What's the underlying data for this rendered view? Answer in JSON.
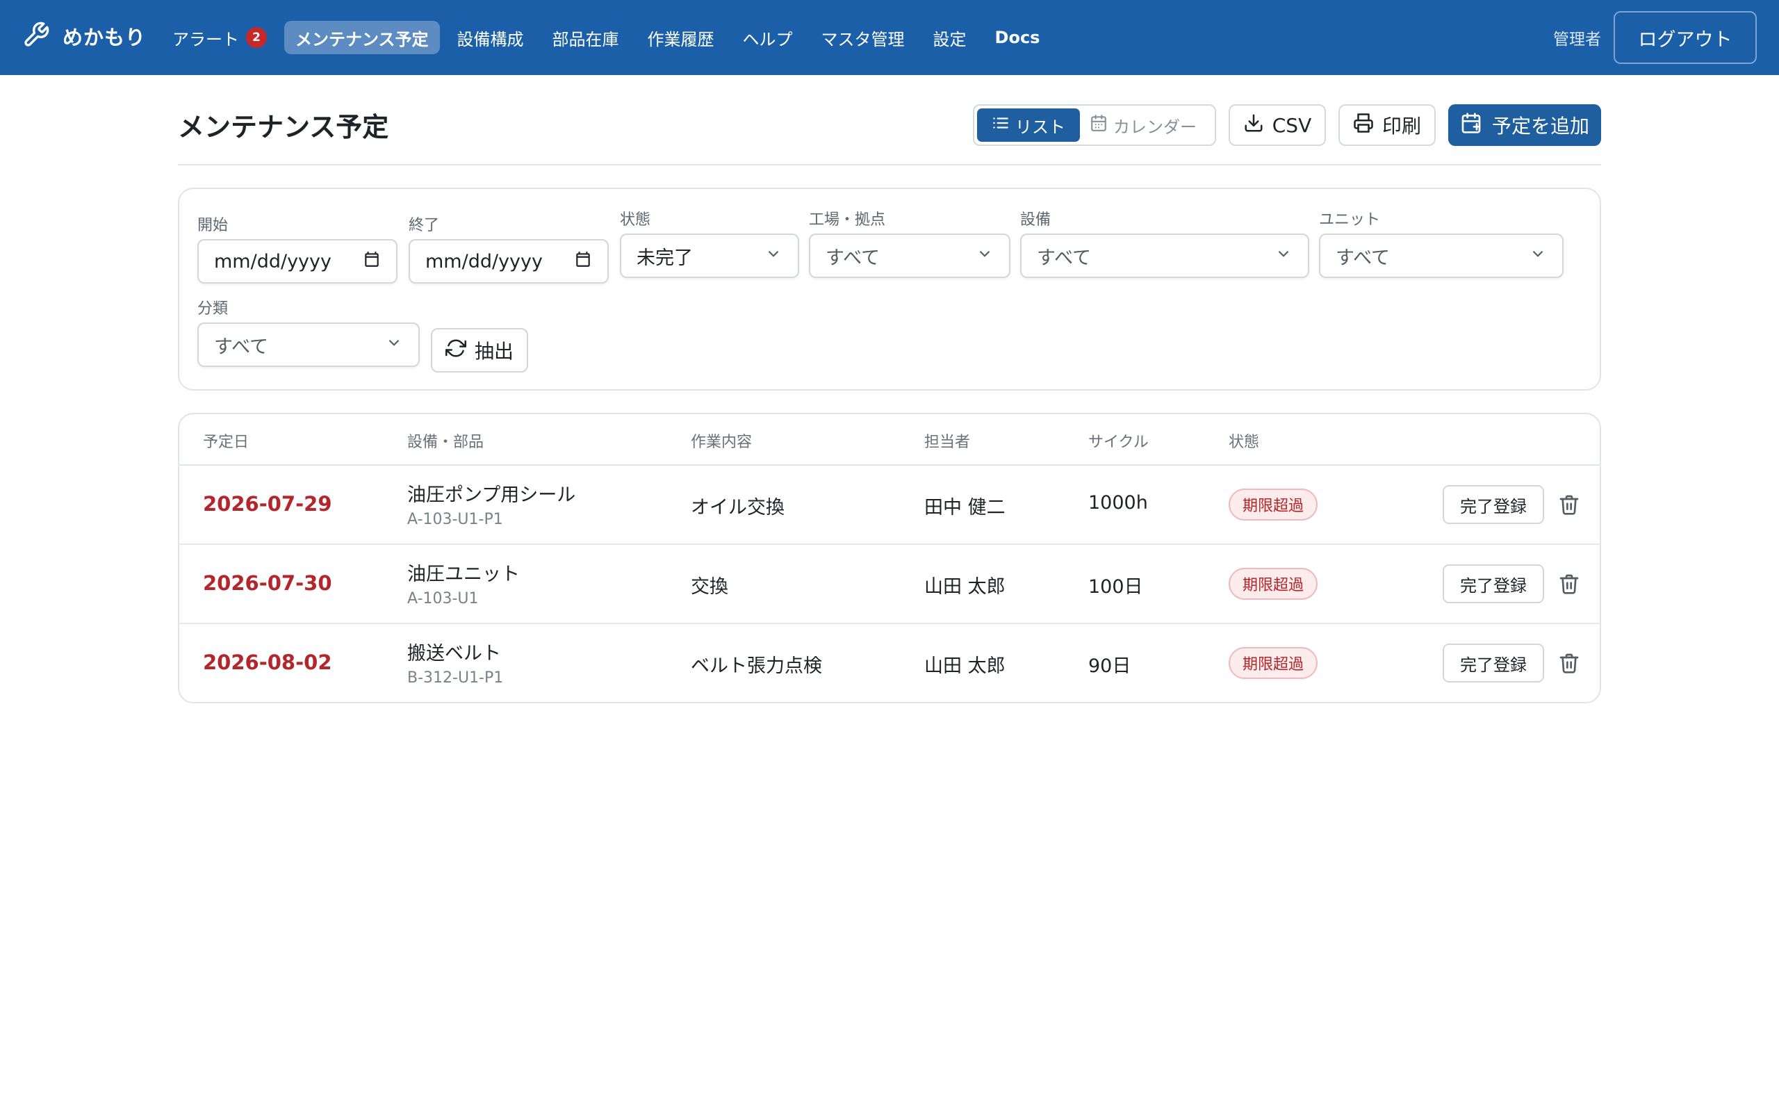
{
  "nav": {
    "brand": "めかもり",
    "items": [
      {
        "label": "アラート",
        "badge": "2"
      },
      {
        "label": "メンテナンス予定"
      },
      {
        "label": "設備構成"
      },
      {
        "label": "部品在庫"
      },
      {
        "label": "作業履歴"
      },
      {
        "label": "ヘルプ"
      },
      {
        "label": "マスタ管理"
      },
      {
        "label": "設定"
      },
      {
        "label": "Docs"
      }
    ],
    "user": "管理者",
    "logout": "ログアウト"
  },
  "header": {
    "title": "メンテナンス予定",
    "view_list": "リスト",
    "view_calendar": "カレンダー",
    "csv": "CSV",
    "print": "印刷",
    "add": "予定を追加"
  },
  "filters": {
    "start_label": "開始",
    "start_value": "mm/dd/yyyy",
    "end_label": "終了",
    "end_value": "mm/dd/yyyy",
    "status_label": "状態",
    "status_value": "未完了",
    "site_label": "工場・拠点",
    "site_value": "すべて",
    "equipment_label": "設備",
    "equipment_value": "すべて",
    "unit_label": "ユニット",
    "unit_value": "すべて",
    "category_label": "分類",
    "category_value": "すべて",
    "extract": "抽出"
  },
  "table": {
    "headers": [
      "予定日",
      "設備・部品",
      "作業内容",
      "担当者",
      "サイクル",
      "状態"
    ],
    "rows": [
      {
        "date": "2026-07-29",
        "part": "油圧ポンプ用シール",
        "code": "A-103-U1-P1",
        "task": "オイル交換",
        "person": "田中 健二",
        "cycle": "1000h",
        "status": "期限超過",
        "action": "完了登録"
      },
      {
        "date": "2026-07-30",
        "part": "油圧ユニット",
        "code": "A-103-U1",
        "task": "交換",
        "person": "山田 太郎",
        "cycle": "100日",
        "status": "期限超過",
        "action": "完了登録"
      },
      {
        "date": "2026-08-02",
        "part": "搬送ベルト",
        "code": "B-312-U1-P1",
        "task": "ベルト張力点検",
        "person": "山田 太郎",
        "cycle": "90日",
        "status": "期限超過",
        "action": "完了登録"
      }
    ]
  },
  "colors": {
    "nav_bg": "#1b5fa8",
    "primary": "#1f5fa0",
    "overdue": "#b3262b"
  }
}
